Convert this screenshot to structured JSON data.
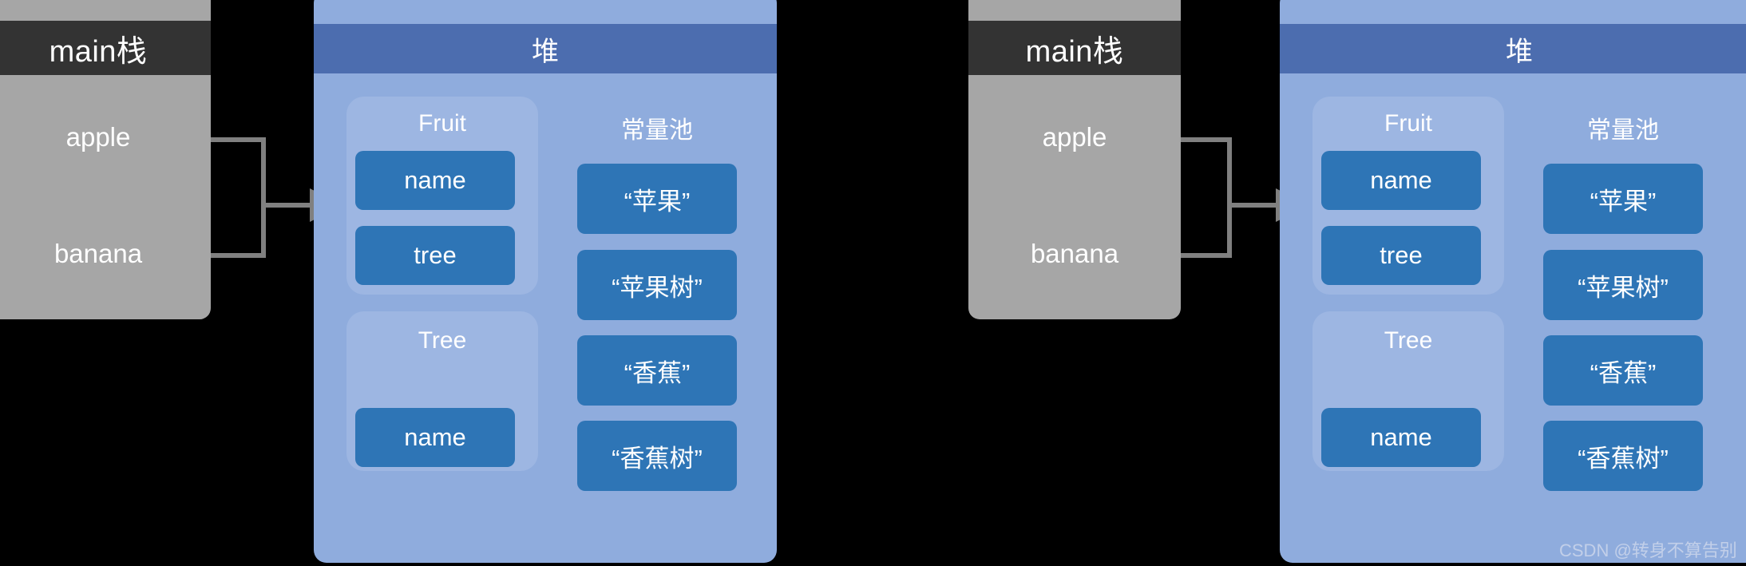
{
  "colors": {
    "background": "#000000",
    "stack_body": "#A6A6A6",
    "stack_header": "#333333",
    "heap_body": "#8FACDD",
    "heap_header": "#4C6DAF",
    "group_body": "#9DB6E2",
    "field_box": "#2E75B6",
    "wire": "#808080",
    "text": "#FFFFFF"
  },
  "watermark": "CSDN @转身不算告别",
  "diagrams": [
    {
      "id": "before",
      "stack": {
        "title": "main栈",
        "slots": [
          {
            "label": "apple"
          },
          {
            "label": "banana"
          }
        ]
      },
      "heap": {
        "title": "堆",
        "groups": [
          {
            "title": "Fruit",
            "fields": [
              {
                "label": "name"
              },
              {
                "label": "tree"
              }
            ]
          },
          {
            "title": "Tree",
            "fields": [
              {
                "label": "name"
              }
            ]
          }
        ],
        "pool": {
          "title": "常量池",
          "entries": [
            {
              "label": "“苹果”"
            },
            {
              "label": "“苹果树”"
            },
            {
              "label": "“香蕉”"
            },
            {
              "label": "“香蕉树”"
            }
          ]
        }
      }
    },
    {
      "id": "after",
      "stack": {
        "title": "main栈",
        "slots": [
          {
            "label": "apple"
          },
          {
            "label": "banana"
          }
        ]
      },
      "heap": {
        "title": "堆",
        "groups": [
          {
            "title": "Fruit",
            "fields": [
              {
                "label": "name"
              },
              {
                "label": "tree"
              }
            ]
          },
          {
            "title": "Tree",
            "fields": [
              {
                "label": "name"
              }
            ]
          }
        ],
        "pool": {
          "title": "常量池",
          "entries": [
            {
              "label": "“苹果”"
            },
            {
              "label": "“苹果树”"
            },
            {
              "label": "“香蕉”"
            },
            {
              "label": "“香蕉树”"
            }
          ]
        }
      }
    }
  ]
}
